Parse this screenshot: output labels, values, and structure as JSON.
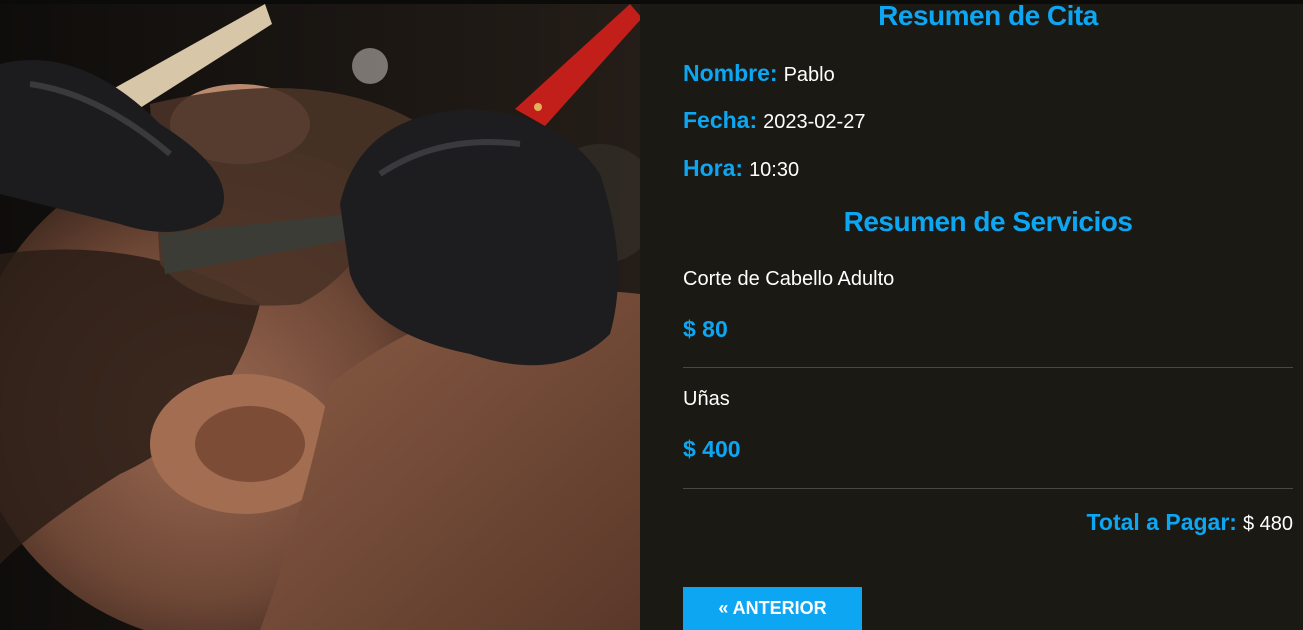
{
  "theme": {
    "accent": "#0da6f3",
    "background": "#1a1914",
    "text": "#ffffff"
  },
  "photo": {
    "subject": "barber-shaving-client-image"
  },
  "appointment": {
    "heading": "Resumen de Cita",
    "name_label": "Nombre:",
    "name_value": "Pablo",
    "date_label": "Fecha:",
    "date_value": "2023-02-27",
    "time_label": "Hora:",
    "time_value": "10:30"
  },
  "services": {
    "heading": "Resumen de Servicios",
    "items": [
      {
        "name": "Corte de Cabello Adulto",
        "price": "$ 80"
      },
      {
        "name": "Uñas",
        "price": "$ 400"
      }
    ]
  },
  "total": {
    "label": "Total a Pagar:",
    "value": "$ 480"
  },
  "navigation": {
    "previous_label": "« Anterior"
  }
}
